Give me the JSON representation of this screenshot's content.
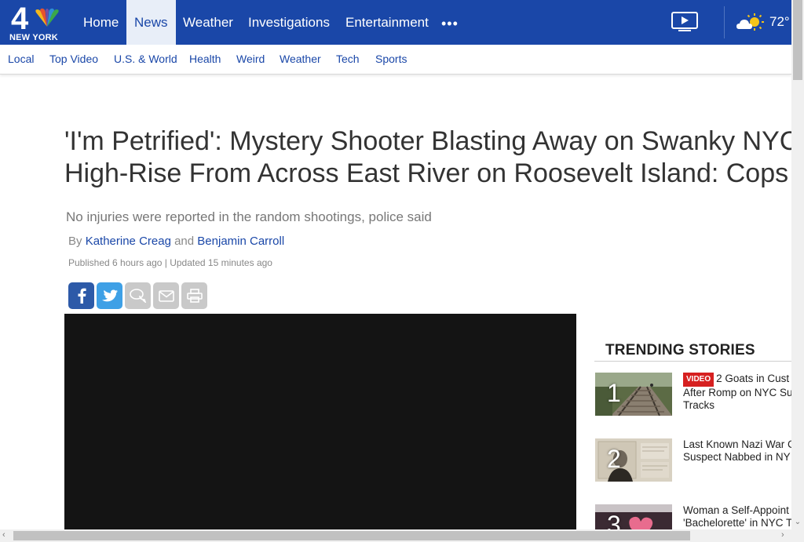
{
  "brand": {
    "number": "4",
    "name": "NEW YORK"
  },
  "nav": {
    "items": [
      {
        "label": "Home"
      },
      {
        "label": "News"
      },
      {
        "label": "Weather"
      },
      {
        "label": "Investigations"
      },
      {
        "label": "Entertainment"
      }
    ],
    "more_label": "•••",
    "temperature": "72°"
  },
  "subnav": {
    "items": [
      {
        "label": "Local"
      },
      {
        "label": "Top Video"
      },
      {
        "label": "U.S. & World"
      },
      {
        "label": "Health"
      },
      {
        "label": "Weird"
      },
      {
        "label": "Weather"
      },
      {
        "label": "Tech"
      },
      {
        "label": "Sports"
      }
    ]
  },
  "article": {
    "headline_line1": "'I'm Petrified': Mystery Shooter Blasting Away on Swanky NYC",
    "headline_line2": "High-Rise From Across East River on Roosevelt Island: Cops",
    "subhead": "No injuries were reported in the random shootings, police said",
    "by": "By",
    "author1": "Katherine Creag",
    "and": "and",
    "author2": "Benjamin Carroll",
    "published": "Published 6 hours ago | Updated 15 minutes ago"
  },
  "trending": {
    "title": "TRENDING STORIES",
    "items": [
      {
        "num": "1",
        "badge": "VIDEO",
        "line1": "2 Goats in Cust",
        "line2": "After Romp on NYC Su",
        "line3": "Tracks"
      },
      {
        "num": "2",
        "line1": "Last Known Nazi War C",
        "line2": "Suspect Nabbed in NY"
      },
      {
        "num": "3",
        "line1": "Woman a Self-Appoint",
        "line2": "'Bachelorette' in NYC T"
      }
    ]
  },
  "colors": {
    "brand_blue": "#1a47a8",
    "video_badge": "#d62020"
  }
}
